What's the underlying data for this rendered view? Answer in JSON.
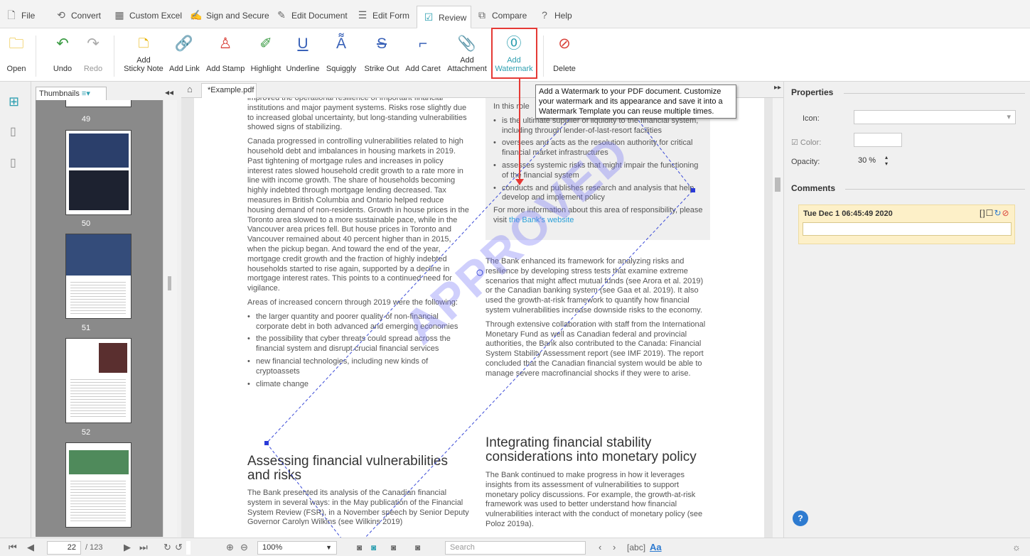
{
  "menu": [
    {
      "icon": "🗋",
      "label": "File"
    },
    {
      "icon": "⟲",
      "label": "Convert"
    },
    {
      "icon": "▦",
      "label": "Custom Excel"
    },
    {
      "icon": "✍",
      "label": "Sign and Secure"
    },
    {
      "icon": "✎",
      "label": "Edit Document"
    },
    {
      "icon": "☰",
      "label": "Edit Form"
    },
    {
      "icon": "☑",
      "label": "Review"
    },
    {
      "icon": "⧉",
      "label": "Compare"
    },
    {
      "icon": "?",
      "label": "Help"
    }
  ],
  "ribbon": {
    "open": "Open",
    "undo": "Undo",
    "redo": "Redo",
    "sticky_note": "Add\nSticky Note",
    "add_link": "Add Link",
    "add_stamp": "Add Stamp",
    "highlight": "Highlight",
    "underline": "Underline",
    "squiggly": "Squiggly",
    "strike_out": "Strike Out",
    "add_caret": "Add Caret",
    "add_attachment": "Add\nAttachment",
    "add_watermark": "Add\nWatermark",
    "delete": "Delete"
  },
  "tooltip": "Add a Watermark to your PDF document. Customize your watermark and its appearance and save it into a Watermark Template you can reuse multiple times.",
  "thumbnails": {
    "selector": "Thumbnails",
    "pages": [
      "49",
      "50",
      "51",
      "52"
    ]
  },
  "doc": {
    "tab": "*Example.pdf",
    "left_col": [
      "improved the operational resilience of important financial institutions and major payment systems. Risks rose slightly due to increased global uncertainty, but long-standing vulnerabilities showed signs of stabilizing.",
      "Canada progressed in controlling vulnerabilities related to high household debt and imbalances in housing markets in 2019. Past tightening of mortgage rules and increases in policy interest rates slowed household credit growth to a rate more in line with income growth. The share of households becoming highly indebted through mortgage lending decreased. Tax measures in British Columbia and Ontario helped reduce housing demand of non-residents. Growth in house prices in the Toronto area slowed to a more sustainable pace, while in the Vancouver area prices fell. But house prices in Toronto and Vancouver remained about 40 percent higher than in 2015, when the pickup began. And toward the end of the year, mortgage credit growth and the fraction of highly indebted households started to rise again, supported by a decline in mortgage interest rates. This points to a continued need for vigilance.",
      "Areas of increased concern through 2019 were the following:"
    ],
    "left_bullets": [
      "the larger quantity and poorer quality of non-financial corporate debt in both advanced and emerging economies",
      "the possibility that cyber threats could spread across the financial system and disrupt crucial financial services",
      "new financial technologies, including new kinds of cryptoassets",
      "climate change"
    ],
    "heading1": "Assessing financial vulnerabilities and risks",
    "left_after": "The Bank presented its analysis of the Canadian financial system in several ways: in the May publication of the Financial System Review (FSR), in a November speech by Senior Deputy Governor Carolyn Wilkins (see Wilkins 2019)",
    "box_intro": "In this role",
    "box_bullets": [
      "is the ultimate supplier of liquidity to the financial system, including through lender-of-last-resort facilities",
      "oversees and acts as the resolution authority for critical financial market infrastructures",
      "assesses systemic risks that might impair the functioning of the financial system",
      "conducts and publishes research and analysis that help develop and implement policy"
    ],
    "box_more": "For more information about this area of responsibility, please visit",
    "box_link": "the Bank's website",
    "right_col": [
      "The Bank enhanced its framework for analyzing risks and resilience by developing stress tests that examine extreme scenarios that might affect mutual funds (see Arora et al. 2019) or the Canadian banking system (see Gaa et al. 2019). It also used the growth-at-risk framework to quantify how financial system vulnerabilities increase downside risks to the economy.",
      "Through extensive collaboration with staff from the International Monetary Fund as well as Canadian federal and provincial authorities, the Bank also contributed to the Canada: Financial System Stability Assessment report (see IMF 2019). The report concluded that the Canadian financial system would be able to manage severe macrofinancial shocks if they were to arise."
    ],
    "heading2": "Integrating financial stability considerations into monetary policy",
    "right_after": "The Bank continued to make progress in how it leverages insights from its assessment of vulnerabilities to support monetary policy discussions. For example, the growth-at-risk framework was used to better understand how financial vulnerabilities interact with the conduct of monetary policy (see Poloz 2019a).",
    "watermark": "APPROVED"
  },
  "properties": {
    "title": "Properties",
    "icon_label": "Icon:",
    "color_label": "Color:",
    "opacity_label": "Opacity:",
    "opacity_value": "30 %",
    "comments_title": "Comments",
    "comment_date": "Tue Dec 1 06:45:49 2020"
  },
  "status": {
    "page": "22",
    "total": "/ 123",
    "zoom": "100%",
    "search_placeholder": "Search",
    "abc": "abc",
    "aa": "Aa"
  }
}
